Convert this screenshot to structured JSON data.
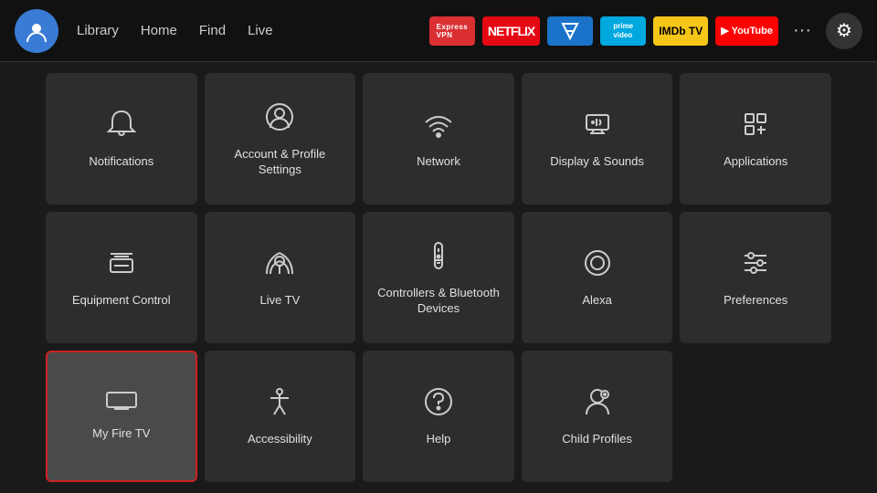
{
  "nav": {
    "links": [
      "Library",
      "Home",
      "Find",
      "Live"
    ],
    "apps": [
      {
        "label": "ExpressVPN",
        "class": "badge-expressvpn"
      },
      {
        "label": "NETFLIX",
        "class": "badge-netflix"
      },
      {
        "label": "≋",
        "class": "badge-freeveelite"
      },
      {
        "label": "prime video",
        "class": "badge-prime"
      },
      {
        "label": "IMDb TV",
        "class": "badge-imdb"
      },
      {
        "label": "▶ YouTube",
        "class": "badge-youtube"
      }
    ],
    "more_label": "···",
    "settings_icon": "⚙"
  },
  "grid": {
    "cells": [
      {
        "id": "notifications",
        "label": "Notifications",
        "icon": "bell"
      },
      {
        "id": "account-profile",
        "label": "Account & Profile Settings",
        "icon": "person-circle"
      },
      {
        "id": "network",
        "label": "Network",
        "icon": "wifi"
      },
      {
        "id": "display-sounds",
        "label": "Display & Sounds",
        "icon": "display-sound"
      },
      {
        "id": "applications",
        "label": "Applications",
        "icon": "apps-grid"
      },
      {
        "id": "equipment-control",
        "label": "Equipment Control",
        "icon": "tv-remote"
      },
      {
        "id": "live-tv",
        "label": "Live TV",
        "icon": "antenna"
      },
      {
        "id": "controllers-bluetooth",
        "label": "Controllers & Bluetooth Devices",
        "icon": "remote"
      },
      {
        "id": "alexa",
        "label": "Alexa",
        "icon": "alexa"
      },
      {
        "id": "preferences",
        "label": "Preferences",
        "icon": "sliders"
      },
      {
        "id": "my-fire-tv",
        "label": "My Fire TV",
        "icon": "fire-tv",
        "selected": true
      },
      {
        "id": "accessibility",
        "label": "Accessibility",
        "icon": "accessibility"
      },
      {
        "id": "help",
        "label": "Help",
        "icon": "question"
      },
      {
        "id": "child-profiles",
        "label": "Child Profiles",
        "icon": "child-profile"
      }
    ]
  }
}
